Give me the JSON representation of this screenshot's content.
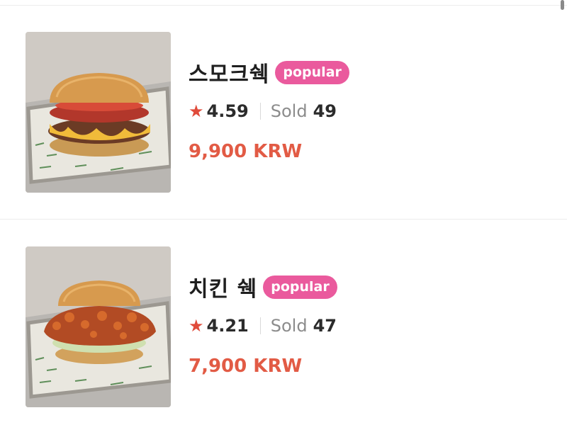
{
  "items": [
    {
      "title": "스모크쉑",
      "badge": "popular",
      "rating": "4.59",
      "sold_label": "Sold",
      "sold_count": "49",
      "price": "9,900 KRW",
      "image_icon": "burger-photo"
    },
    {
      "title": "치킨 쉑",
      "badge": "popular",
      "rating": "4.21",
      "sold_label": "Sold",
      "sold_count": "47",
      "price": "7,900 KRW",
      "image_icon": "chicken-burger-photo"
    }
  ],
  "icons": {
    "star": "★"
  },
  "colors": {
    "badge": "#ea5a9d",
    "price": "#e25b45",
    "star": "#e04b3b"
  }
}
